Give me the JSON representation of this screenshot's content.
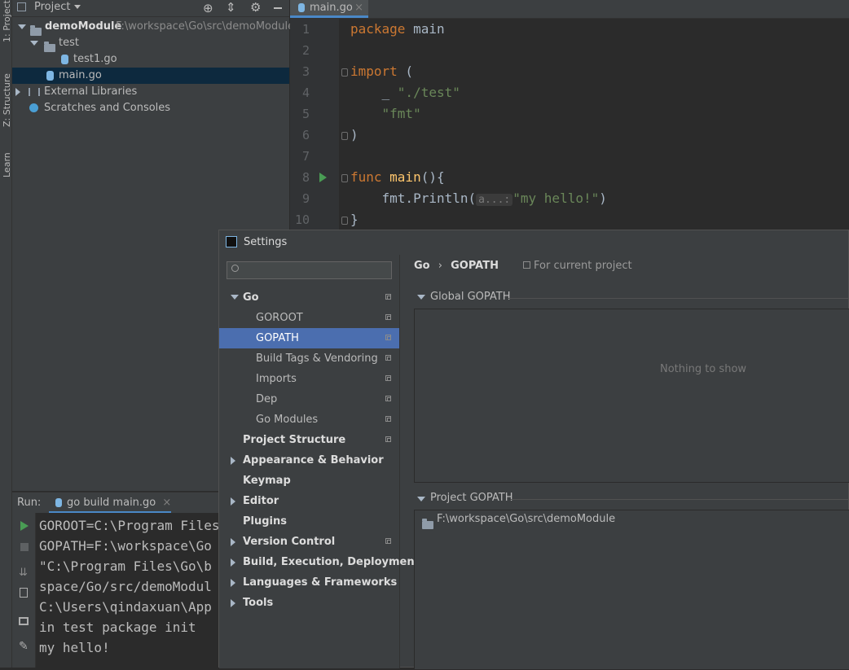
{
  "toolstrip": {
    "tabs": [
      "1: Project",
      "Z: Structure",
      "Learn"
    ]
  },
  "project": {
    "title": "Project",
    "tree": [
      {
        "label": "demoModule",
        "path": "F:\\workspace\\Go\\src\\demoModule"
      },
      {
        "label": "test"
      },
      {
        "label": "test1.go"
      },
      {
        "label": "main.go"
      },
      {
        "label": "External Libraries"
      },
      {
        "label": "Scratches and Consoles"
      }
    ]
  },
  "editor": {
    "tab": "main.go",
    "line_numbers": [
      "1",
      "2",
      "3",
      "4",
      "5",
      "6",
      "7",
      "8",
      "9",
      "10"
    ],
    "code": {
      "l1_kw": "package",
      "l1_rest": " main",
      "l3_kw": "import",
      "l3_rest": " (",
      "l4_pre": "    _ ",
      "l4_str": "\"./test\"",
      "l5_str": "    \"fmt\"",
      "l6": ")",
      "l8_kw": "func",
      "l8_fn": " main",
      "l8_rest": "(){",
      "l9_pre": "    fmt.Println(",
      "l9_hint": "a...:",
      "l9_str": "\"my hello!\"",
      "l9_post": ")",
      "l10": "}"
    }
  },
  "run": {
    "label": "Run:",
    "tab": "go build main.go",
    "console": [
      "GOROOT=C:\\Program Files",
      "GOPATH=F:\\workspace\\Go",
      "\"C:\\Program Files\\Go\\b",
      "space/Go/src/demoModul",
      "C:\\Users\\qindaxuan\\App",
      "in test package init",
      "my hello!"
    ]
  },
  "settings": {
    "title": "Settings",
    "search_placeholder": "",
    "nav": [
      {
        "label": "Go"
      },
      {
        "label": "GOROOT"
      },
      {
        "label": "GOPATH"
      },
      {
        "label": "Build Tags & Vendoring"
      },
      {
        "label": "Imports"
      },
      {
        "label": "Dep"
      },
      {
        "label": "Go Modules"
      },
      {
        "label": "Project Structure"
      },
      {
        "label": "Appearance & Behavior"
      },
      {
        "label": "Keymap"
      },
      {
        "label": "Editor"
      },
      {
        "label": "Plugins"
      },
      {
        "label": "Version Control"
      },
      {
        "label": "Build, Execution, Deployment"
      },
      {
        "label": "Languages & Frameworks"
      },
      {
        "label": "Tools"
      }
    ],
    "breadcrumb": {
      "parent": "Go",
      "separator": "›",
      "current": "GOPATH",
      "scope": "For current project"
    },
    "global_gopath": {
      "title": "Global GOPATH",
      "empty": "Nothing to show"
    },
    "project_gopath": {
      "title": "Project GOPATH",
      "entry": "F:\\workspace\\Go\\src\\demoModule"
    }
  },
  "colors": {
    "selection": "#4b6eaf",
    "keyword": "#cc7832",
    "string": "#6a8759",
    "function": "#ffc66d",
    "run_green": "#499c54"
  }
}
